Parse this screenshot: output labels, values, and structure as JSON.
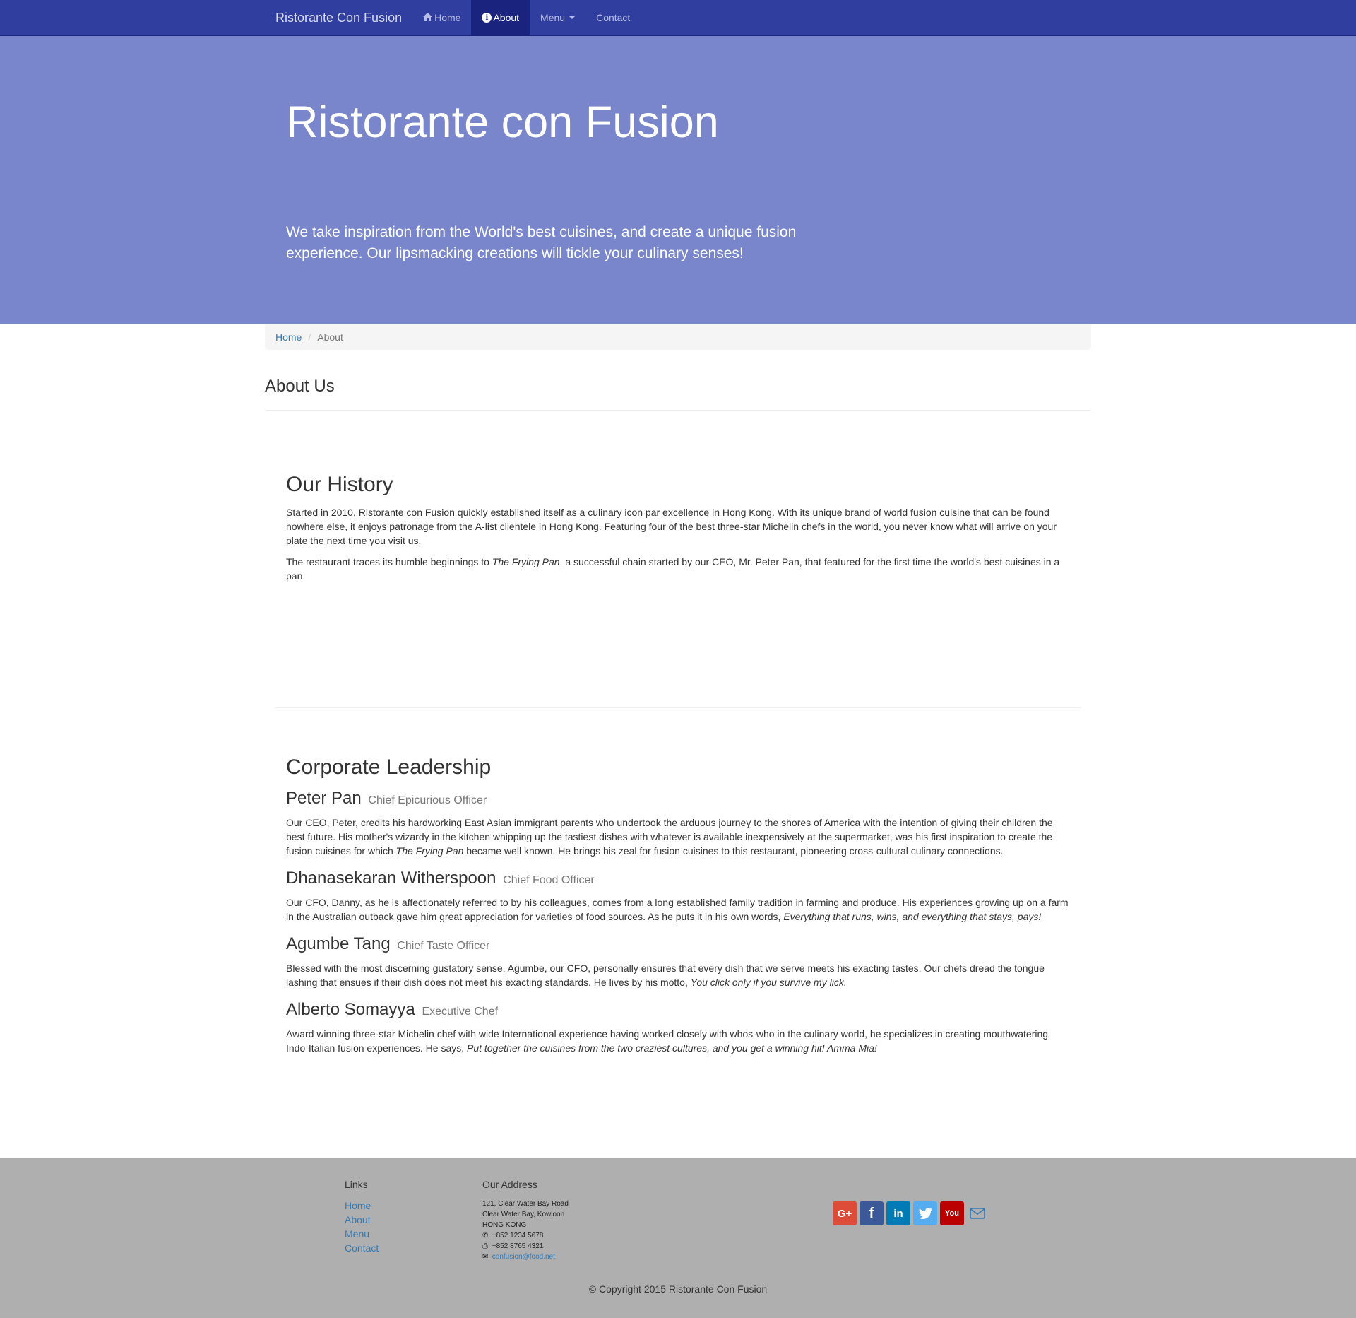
{
  "nav": {
    "brand": "Ristorante Con Fusion",
    "items": [
      {
        "label": "Home"
      },
      {
        "label": "About"
      },
      {
        "label": "Menu"
      },
      {
        "label": "Contact"
      }
    ]
  },
  "jumbotron": {
    "title": "Ristorante con Fusion",
    "text": "We take inspiration from the World's best cuisines, and create a unique fusion experience. Our lipsmacking creations will tickle your culinary senses!"
  },
  "breadcrumb": {
    "home": "Home",
    "separator": "/",
    "current": "About"
  },
  "page_title": "About Us",
  "history": {
    "heading": "Our History",
    "p1": "Started in 2010, Ristorante con Fusion quickly established itself as a culinary icon par excellence in Hong Kong. With its unique brand of world fusion cuisine that can be found nowhere else, it enjoys patronage from the A-list clientele in Hong Kong. Featuring four of the best three-star Michelin chefs in the world, you never know what will arrive on your plate the next time you visit us.",
    "p2_before": "The restaurant traces its humble beginnings to ",
    "p2_em": "The Frying Pan",
    "p2_after": ", a successful chain started by our CEO, Mr. Peter Pan, that featured for the first time the world's best cuisines in a pan."
  },
  "leadership": {
    "heading": "Corporate Leadership",
    "leaders": [
      {
        "name": "Peter Pan",
        "title": "Chief Epicurious Officer",
        "before": "Our CEO, Peter, credits his hardworking East Asian immigrant parents who undertook the arduous journey to the shores of America with the intention of giving their children the best future. His mother's wizardy in the kitchen whipping up the tastiest dishes with whatever is available inexpensively at the supermarket, was his first inspiration to create the fusion cuisines for which ",
        "em": "The Frying Pan",
        "after": " became well known. He brings his zeal for fusion cuisines to this restaurant, pioneering cross-cultural culinary connections."
      },
      {
        "name": "Dhanasekaran Witherspoon",
        "title": "Chief Food Officer",
        "before": "Our CFO, Danny, as he is affectionately referred to by his colleagues, comes from a long established family tradition in farming and produce. His experiences growing up on a farm in the Australian outback gave him great appreciation for varieties of food sources. As he puts it in his own words, ",
        "em": "Everything that runs, wins, and everything that stays, pays!",
        "after": ""
      },
      {
        "name": "Agumbe Tang",
        "title": "Chief Taste Officer",
        "before": "Blessed with the most discerning gustatory sense, Agumbe, our CFO, personally ensures that every dish that we serve meets his exacting tastes. Our chefs dread the tongue lashing that ensues if their dish does not meet his exacting standards. He lives by his motto, ",
        "em": "You click only if you survive my lick.",
        "after": ""
      },
      {
        "name": "Alberto Somayya",
        "title": "Executive Chef",
        "before": "Award winning three-star Michelin chef with wide International experience having worked closely with whos-who in the culinary world, he specializes in creating mouthwatering Indo-Italian fusion experiences. He says, ",
        "em": "Put together the cuisines from the two craziest cultures, and you get a winning hit! Amma Mia!",
        "after": ""
      }
    ]
  },
  "footer": {
    "links_heading": "Links",
    "links": [
      "Home",
      "About",
      "Menu",
      "Contact"
    ],
    "address_heading": "Our Address",
    "address_lines": [
      "121, Clear Water Bay Road",
      "Clear Water Bay, Kowloon",
      "HONG KONG"
    ],
    "phone": "+852 1234 5678",
    "fax": "+852 8765 4321",
    "email": "confusion@food.net",
    "social": [
      "google-plus",
      "facebook",
      "linkedin",
      "twitter",
      "youtube",
      "email"
    ],
    "copyright": "© Copyright 2015 Ristorante Con Fusion"
  },
  "colors": {
    "primary": "#303f9f",
    "primary_dark": "#1a237e",
    "primary_light": "#7986cb",
    "footer_bg": "#afafaf",
    "link": "#337ab7"
  }
}
